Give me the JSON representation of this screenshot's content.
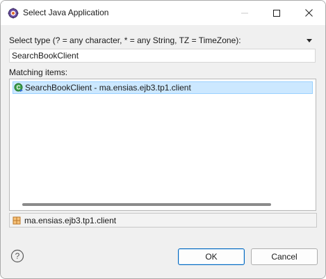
{
  "window": {
    "title": "Select Java Application",
    "accent": "#0067c0"
  },
  "filter": {
    "label": "Select type (? = any character, * = any String, TZ = TimeZone):",
    "value": "SearchBookClient"
  },
  "matching": {
    "label": "Matching items:",
    "items": [
      {
        "label": "SearchBookClient - ma.ensias.ejb3.tp1.client",
        "icon": "java-class-main-icon",
        "selected": true
      }
    ]
  },
  "details": {
    "package": "ma.ensias.ejb3.tp1.client",
    "icon": "package-icon"
  },
  "buttons": {
    "ok": "OK",
    "cancel": "Cancel"
  },
  "icons": {
    "app": "eclipse-gear-icon",
    "help": "help-icon",
    "minimize": "minimize-icon",
    "maximize": "maximize-icon",
    "close": "close-icon",
    "menu": "view-menu-icon"
  }
}
